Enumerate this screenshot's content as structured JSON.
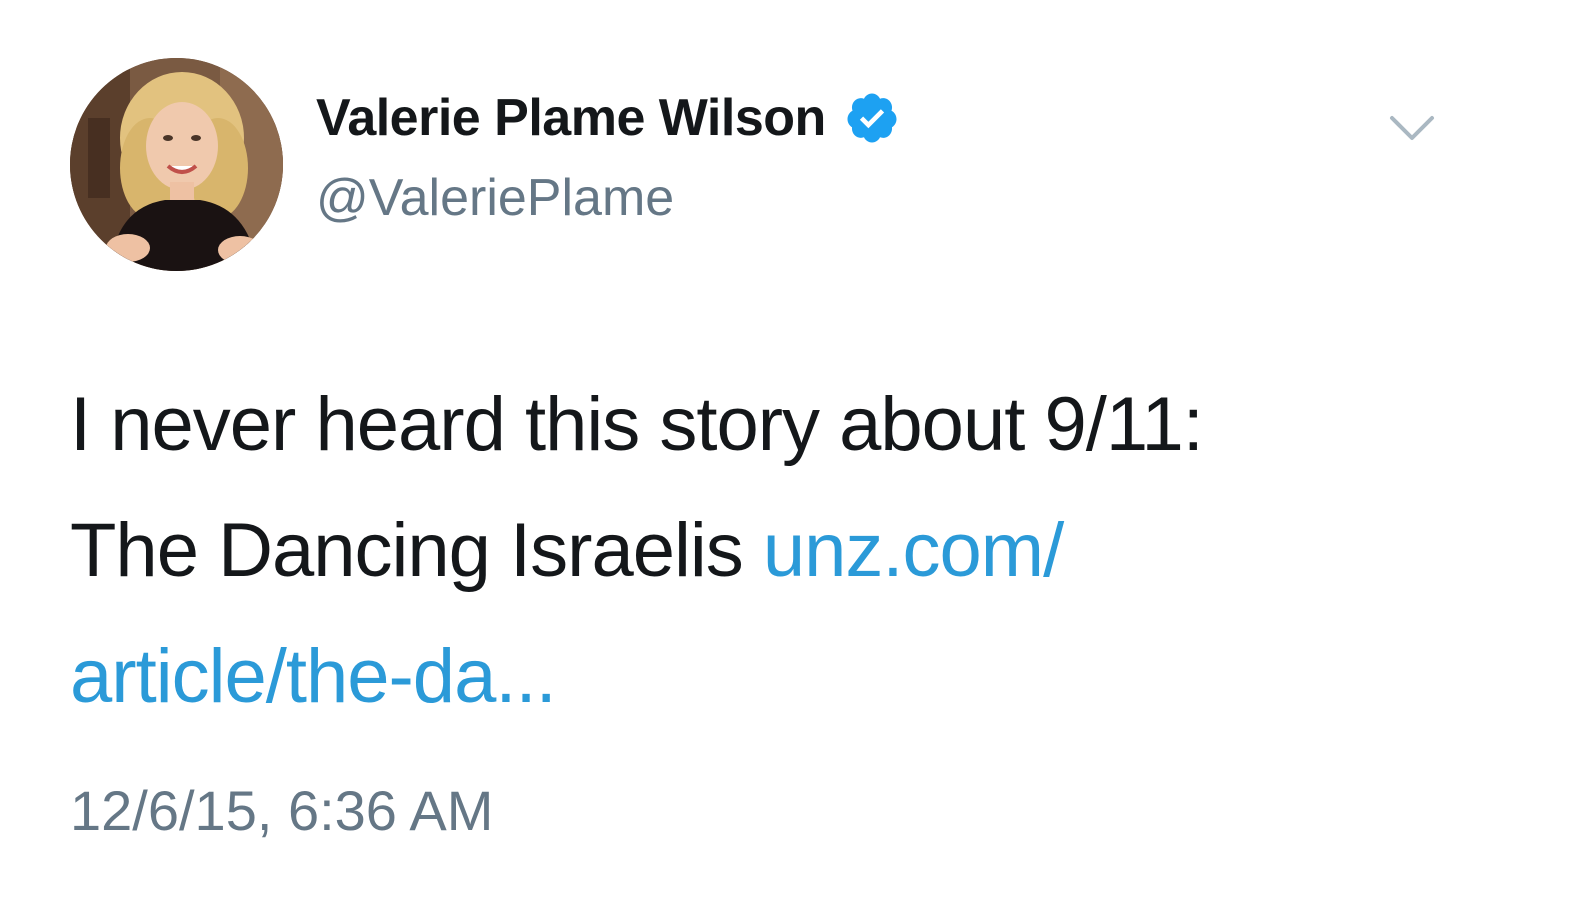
{
  "tweet": {
    "author": {
      "display_name": "Valerie Plame Wilson",
      "handle": "@ValeriePlame",
      "verified": true
    },
    "icons": {
      "verified": "verified-badge-icon",
      "menu": "chevron-down-icon"
    },
    "text": {
      "line1": "I never heard this story about 9/11:",
      "line2_prefix": "The Dancing Israelis",
      "link_part1": "unz.com/",
      "link_part2": "article/the-da..."
    },
    "timestamp": "12/6/15, 6:36 AM",
    "colors": {
      "link": "#2b9ad8",
      "verified": "#1da1f2",
      "secondary_text": "#657786",
      "primary_text": "#14171a"
    }
  }
}
